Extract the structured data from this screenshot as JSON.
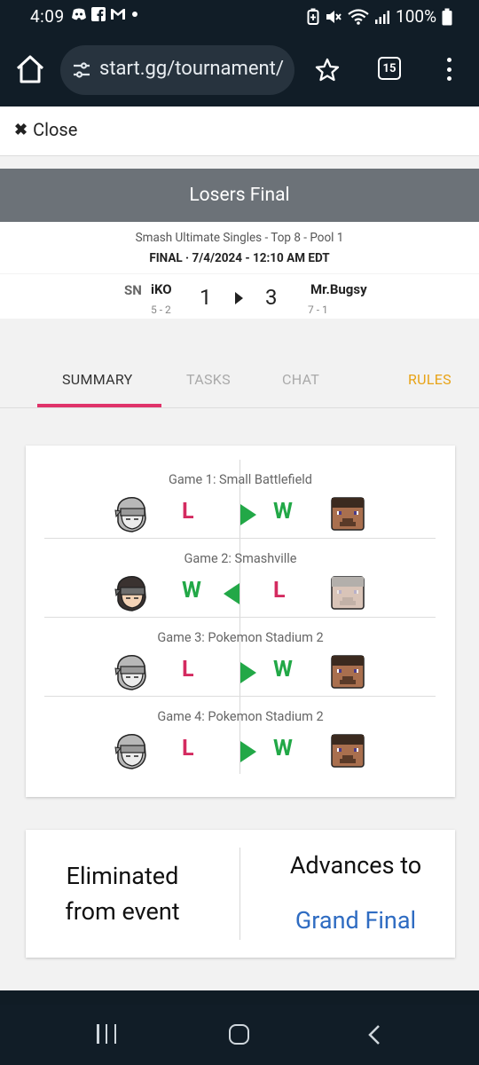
{
  "status_bar": {
    "time": "4:09",
    "left_icons": [
      "discord-icon",
      "facebook-icon",
      "gmail-icon",
      "dot-icon"
    ],
    "right_icons": [
      "battery-saver-icon",
      "mute-icon",
      "wifi-icon",
      "signal-icon"
    ],
    "battery": "100%"
  },
  "browser": {
    "url": "start.gg/tournament/",
    "tab_count": "15"
  },
  "page": {
    "close_label": "Close",
    "round_title": "Losers Final",
    "event_name": "Smash Ultimate Singles - Top 8 - Pool 1",
    "set_status": "FINAL · 7/4/2024 - 12:10 AM EDT",
    "player1": {
      "prefix": "SN",
      "name": "iKO",
      "record": "5 - 2",
      "score": "1"
    },
    "player2": {
      "name": "Mr.Bugsy",
      "record": "7 - 1",
      "score": "3"
    },
    "tabs": {
      "summary": "SUMMARY",
      "tasks": "TASKS",
      "chat": "CHAT",
      "rules": "RULES"
    },
    "games": [
      {
        "title": "Game 1: Small Battlefield",
        "left_result": "L",
        "right_result": "W",
        "winner": "right",
        "left_character": "snake-icon",
        "right_character": "steve-icon"
      },
      {
        "title": "Game 2: Smashville",
        "left_result": "W",
        "right_result": "L",
        "winner": "left",
        "left_character": "snake-icon",
        "right_character": "steve-icon"
      },
      {
        "title": "Game 3: Pokemon Stadium 2",
        "left_result": "L",
        "right_result": "W",
        "winner": "right",
        "left_character": "snake-icon",
        "right_character": "steve-icon"
      },
      {
        "title": "Game 4: Pokemon Stadium 2",
        "left_result": "L",
        "right_result": "W",
        "winner": "right",
        "left_character": "snake-icon",
        "right_character": "steve-icon"
      }
    ],
    "outcome": {
      "eliminated_line1": "Eliminated",
      "eliminated_line2": "from event",
      "advances_label": "Advances to",
      "advances_target": "Grand Final"
    },
    "colors": {
      "win": "#22a847",
      "loss": "#d42b60",
      "accent_tab": "#e0336a",
      "rules": "#e8a317",
      "link": "#2f6cc2"
    }
  }
}
